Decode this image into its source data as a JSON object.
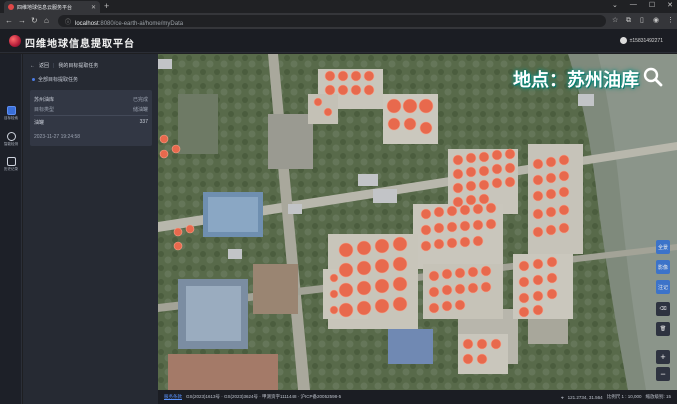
{
  "browser": {
    "tab_title": "四维地球信息云服务平台",
    "url_host": "localhost",
    "url_path": ":8080/ce-earth-ai/home/myData"
  },
  "app": {
    "title": "四维地球信息提取平台",
    "user": "±15831492271"
  },
  "rail": {
    "items": [
      {
        "label": "目标检索"
      },
      {
        "label": "智能检测"
      },
      {
        "label": "历史记录"
      }
    ]
  },
  "panel": {
    "back_label": "返回",
    "breadcrumb": "我的目标提取任务",
    "section_label": "全部目标提取任务",
    "card": {
      "name": "苏州油库",
      "status": "已完成",
      "field_label": "目标类型",
      "field_value": "储油罐",
      "count_label": "油罐",
      "count_value": "337",
      "timestamp": "2023-11-27 19:24:58"
    }
  },
  "map": {
    "overlay_title": "地点：苏州油库",
    "tools": [
      "全景",
      "影像",
      "注记"
    ]
  },
  "statusbar": {
    "link": "服务条款",
    "attribution": "GS(2023)1613号 · GS(2023)3624号 · 甲测资字1111448 · 沪ICP备20052598-5",
    "coords": "121.2734, 31.564",
    "scale": "比例尺 1 : 10,000",
    "zoom": "缩放级别: 15"
  },
  "colors": {
    "accent": "#3c73c9",
    "tank": "#e86a4e",
    "overlay_glow": "#0a8a7c"
  }
}
